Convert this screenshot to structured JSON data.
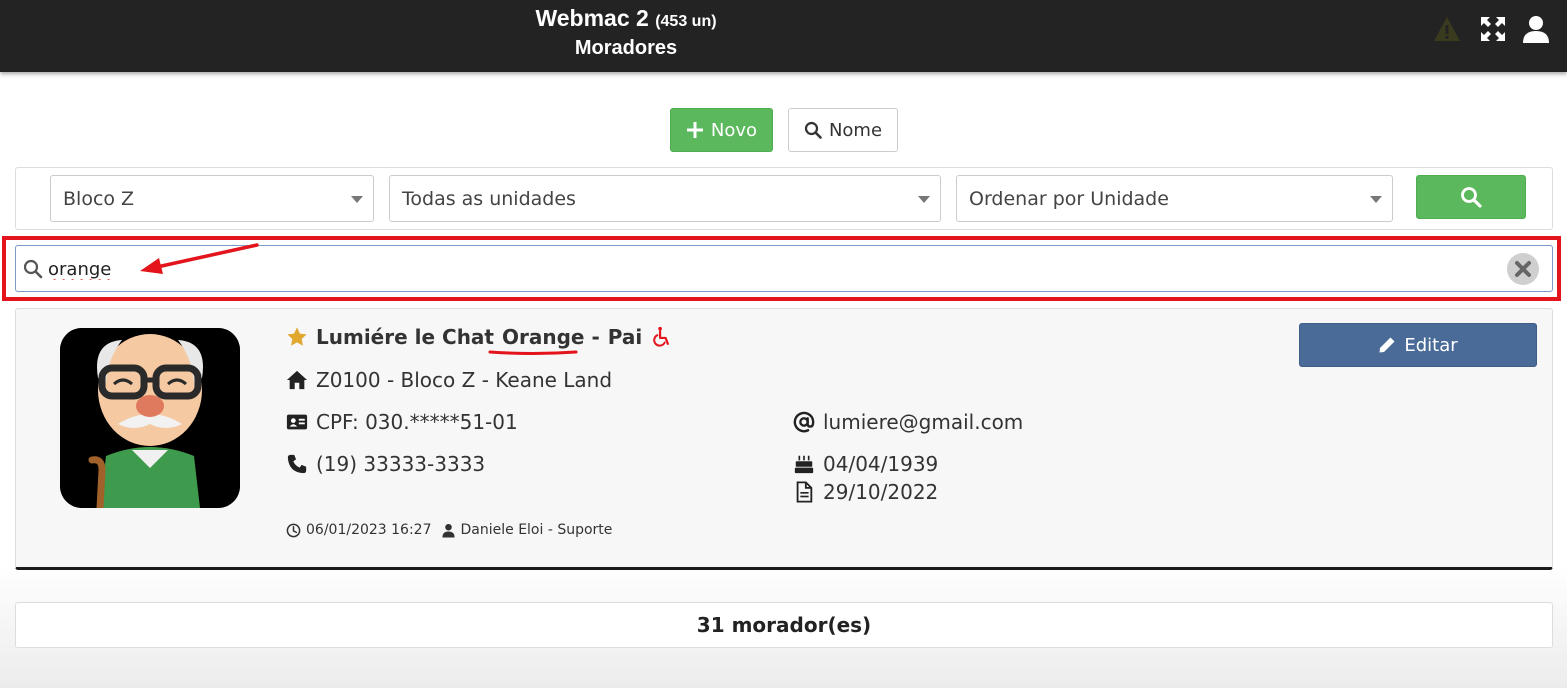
{
  "header": {
    "app_name": "Webmac 2",
    "unit_count": "(453 un)",
    "page_title": "Moradores",
    "icons": [
      "warning-icon",
      "fullscreen-icon",
      "user-icon"
    ]
  },
  "actions": {
    "new_label": "Novo",
    "name_label": "Nome"
  },
  "filters": {
    "block": "Bloco Z",
    "unit": "Todas as unidades",
    "order": "Ordenar por Unidade"
  },
  "search": {
    "value": "orange"
  },
  "resident": {
    "name_prefix": "Lumiére le Chat",
    "name_highlight": "Orange -",
    "name_suffix": "Pai",
    "unit": "Z0100 - Bloco Z - Keane Land",
    "cpf": "CPF: 030.*****51-01",
    "email": "lumiere@gmail.com",
    "phone": "(19) 33333-3333",
    "birth_date": "04/04/1939",
    "doc_date": "29/10/2022",
    "updated_at": "06/01/2023 16:27",
    "updated_by": "Daniele Eloi - Suporte",
    "edit_label": "Editar"
  },
  "footer": {
    "count_label": "31 morador(es)"
  },
  "colors": {
    "header_bg": "#232323",
    "success": "#5cb85c",
    "primary": "#4a6b98",
    "highlight": "#e3141b",
    "star": "#e0a82e"
  }
}
